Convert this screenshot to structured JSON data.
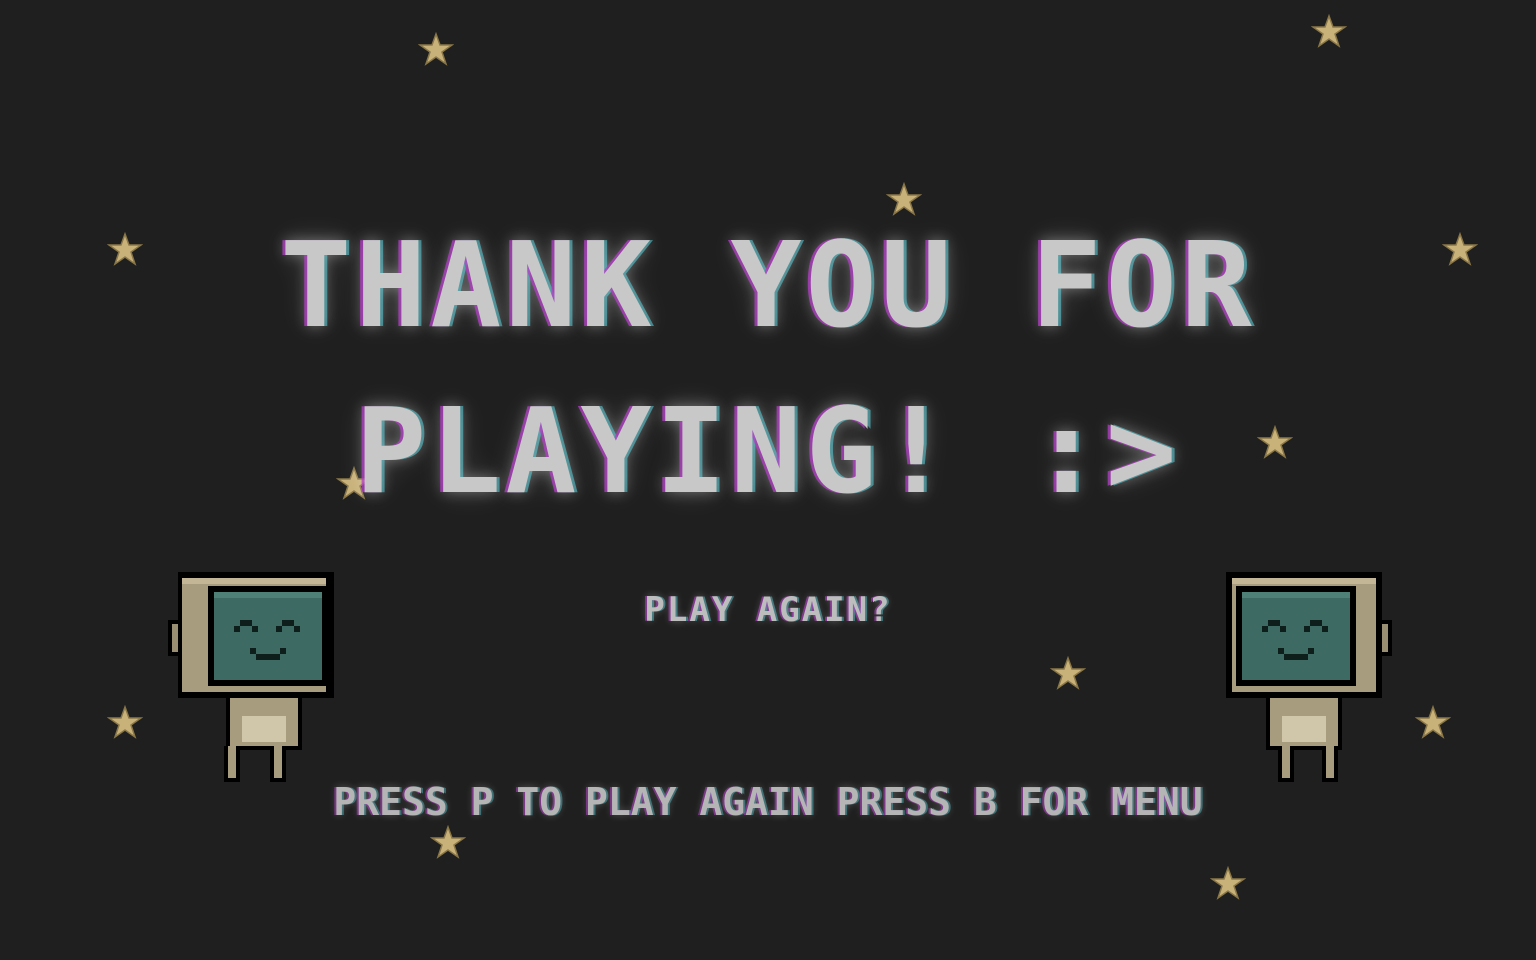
{
  "screen": {
    "title_line_1": "THANK YOU FOR",
    "title_line_2": "PLAYING! :>",
    "play_again_label": "PLAY AGAIN?",
    "instructions": "PRESS P TO PLAY AGAIN PRESS B FOR MENU"
  },
  "colors": {
    "background": "#1f1f1f",
    "text": "#c8c8c8",
    "glitch_magenta": "#b43cc8",
    "glitch_cyan": "#5ad2dc",
    "star": "#c9b27a",
    "robot_body": "#a89c7e",
    "robot_screen": "#3d6b63"
  },
  "icons": {
    "star": "star-icon",
    "robot": "robot-mascot-icon"
  }
}
